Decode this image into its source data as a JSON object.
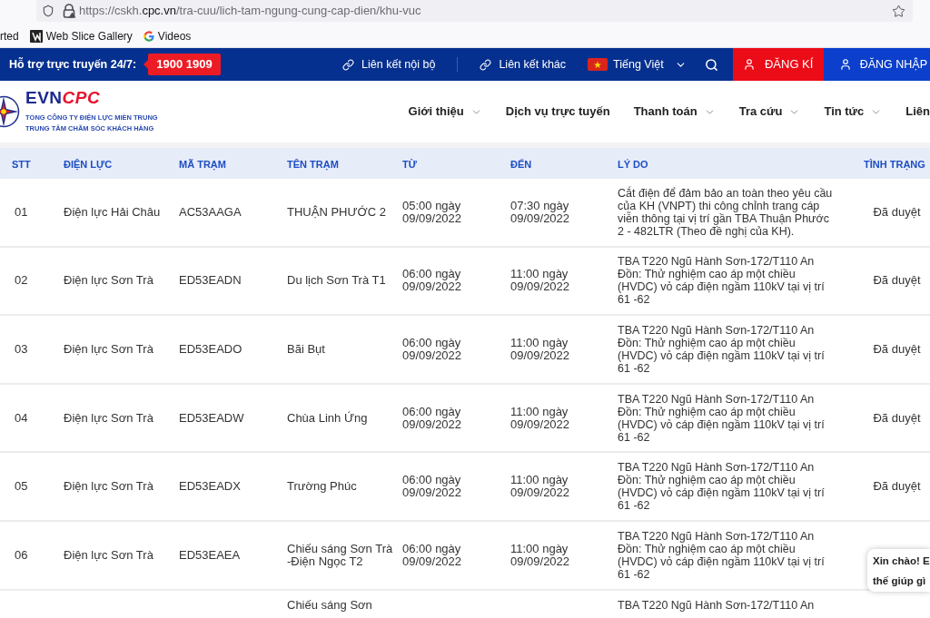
{
  "browser": {
    "url": {
      "before": "https://cskh.",
      "domain": "cpc.vn",
      "after": "/tra-cuu/lich-tam-ngung-cung-cap-dien/khu-vuc"
    },
    "bookmarks": [
      {
        "label": "rted",
        "kind": "plain"
      },
      {
        "label": "Web Slice Gallery",
        "kind": "webslice"
      },
      {
        "label": "Videos",
        "kind": "google"
      }
    ]
  },
  "topbar": {
    "support_label": "Hỗ trợ trực truyến 24/7:",
    "hotline": "1900 1909",
    "links": [
      {
        "label": "Liên kết nội bộ"
      },
      {
        "label": "Liên kết khác"
      }
    ],
    "language": "Tiếng Việt",
    "register": "ĐĂNG KÍ",
    "login": "ĐĂNG NHẬP"
  },
  "header": {
    "logo": {
      "brand_first": "EVN",
      "brand_second": "CPC",
      "line_1": "TỔNG CÔNG TY ĐIỆN LỰC MIỀN TRUNG",
      "line_2": "TRUNG TÂM CHĂM SÓC KHÁCH HÀNG"
    },
    "nav": [
      {
        "label": "Giới thiệu",
        "has_menu": true
      },
      {
        "label": "Dịch vụ trực tuyến",
        "has_menu": false
      },
      {
        "label": "Thanh toán",
        "has_menu": true
      },
      {
        "label": "Tra cứu",
        "has_menu": true
      },
      {
        "label": "Tin tức",
        "has_menu": true
      },
      {
        "label": "Liên",
        "has_menu": false
      }
    ]
  },
  "table": {
    "columns": [
      "STT",
      "ĐIỆN LỰC",
      "MÃ TRẠM",
      "TÊN TRẠM",
      "TỪ",
      "ĐẾN",
      "LÝ DO",
      "TÌNH TRẠNG"
    ],
    "rows": [
      {
        "kind": "full",
        "stt": "01",
        "dien_luc": "Điện lực Hải Châu",
        "ma_tram": "AC53AAGA",
        "ten_tram": "THUẬN PHƯỚC 2",
        "tu": "05:00 ngày 09/09/2022",
        "den": "07:30 ngày 09/09/2022",
        "ly_do": "Cắt điện để đảm bảo an toàn theo yêu cầu của KH (VNPT) thi công chỉnh trang cáp viễn thông tại vị trí gần TBA Thuận Phước 2 - 482LTR (Theo đề nghị của KH).",
        "tinh_trang": "Đã duyệt"
      },
      {
        "kind": "full",
        "stt": "02",
        "dien_luc": "Điện lực Sơn Trà",
        "ma_tram": "ED53EADN",
        "ten_tram": "Du lịch Sơn Trà T1",
        "tu": "06:00 ngày 09/09/2022",
        "den": "11:00 ngày 09/09/2022",
        "ly_do": "TBA T220 Ngũ Hành Sơn-172/T110 An Đồn: Thử nghiệm cao áp một chiều (HVDC) vỏ cáp điện ngầm 110kV tại vị trí 61 -62",
        "tinh_trang": "Đã duyệt"
      },
      {
        "kind": "full",
        "stt": "03",
        "dien_luc": "Điện lực Sơn Trà",
        "ma_tram": "ED53EADO",
        "ten_tram": "Bãi Bụt",
        "tu": "06:00 ngày 09/09/2022",
        "den": "11:00 ngày 09/09/2022",
        "ly_do": "TBA T220 Ngũ Hành Sơn-172/T110 An Đồn: Thử nghiệm cao áp một chiều (HVDC) vỏ cáp điện ngầm 110kV tại vị trí 61 -62",
        "tinh_trang": "Đã duyệt"
      },
      {
        "kind": "full",
        "stt": "04",
        "dien_luc": "Điện lực Sơn Trà",
        "ma_tram": "ED53EADW",
        "ten_tram": "Chùa Linh Ứng",
        "tu": "06:00 ngày 09/09/2022",
        "den": "11:00 ngày 09/09/2022",
        "ly_do": "TBA T220 Ngũ Hành Sơn-172/T110 An Đồn: Thử nghiệm cao áp một chiều (HVDC) vỏ cáp điện ngầm 110kV tại vị trí 61 -62",
        "tinh_trang": "Đã duyệt"
      },
      {
        "kind": "full",
        "stt": "05",
        "dien_luc": "Điện lực Sơn Trà",
        "ma_tram": "ED53EADX",
        "ten_tram": "Trường Phúc",
        "tu": "06:00 ngày 09/09/2022",
        "den": "11:00 ngày 09/09/2022",
        "ly_do": "TBA T220 Ngũ Hành Sơn-172/T110 An Đồn: Thử nghiệm cao áp một chiều (HVDC) vỏ cáp điện ngầm 110kV tại vị trí 61 -62",
        "tinh_trang": "Đã duyệt"
      },
      {
        "kind": "full",
        "stt": "06",
        "dien_luc": "Điện lực Sơn Trà",
        "ma_tram": "ED53EAEA",
        "ten_tram": "Chiếu sáng Sơn Trà -Điện Ngọc T2",
        "tu": "06:00 ngày 09/09/2022",
        "den": "11:00 ngày 09/09/2022",
        "ly_do": "TBA T220 Ngũ Hành Sơn-172/T110 An Đồn: Thử nghiệm cao áp một chiều (HVDC) vỏ cáp điện ngầm 110kV tại vị trí 61 -62"
      },
      {
        "kind": "clipped",
        "ten_tram": "Chiếu sáng Sơn",
        "ly_do": "TBA T220 Ngũ Hành Sơn-172/T110 An"
      }
    ]
  },
  "chat_bubble": {
    "lines": [
      "Xin chào! E",
      "thế giúp gì"
    ]
  }
}
